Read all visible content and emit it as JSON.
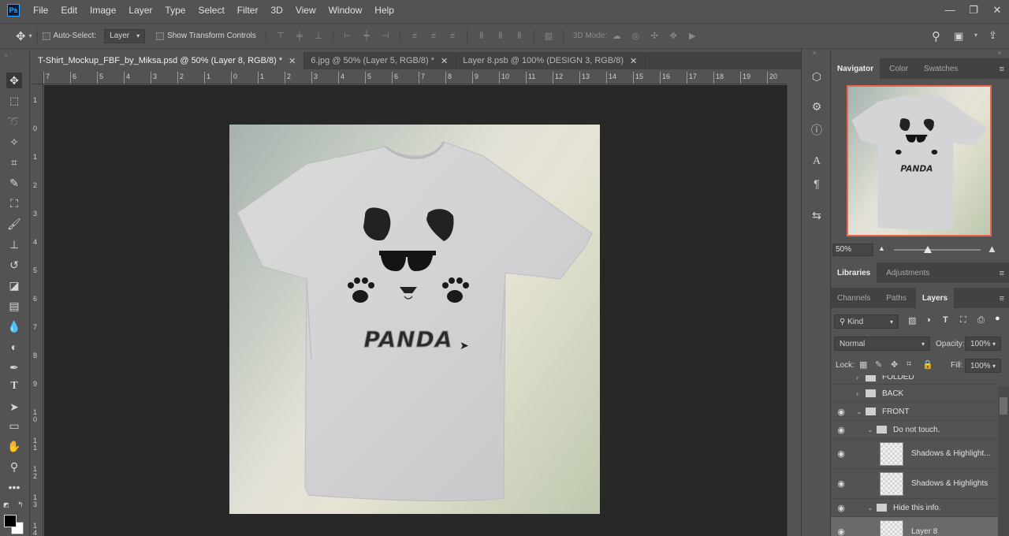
{
  "app": {
    "logo": "Ps"
  },
  "menu": [
    "File",
    "Edit",
    "Image",
    "Layer",
    "Type",
    "Select",
    "Filter",
    "3D",
    "View",
    "Window",
    "Help"
  ],
  "window_controls": [
    "—",
    "❐",
    "✕"
  ],
  "options": {
    "auto_select_label": "Auto-Select:",
    "auto_select_value": "Layer",
    "show_transform_label": "Show Transform Controls",
    "mode_3d_label": "3D Mode:"
  },
  "tabs": [
    {
      "label": "T-Shirt_Mockup_FBF_by_Miksa.psd @ 50% (Layer 8, RGB/8) *",
      "close": "✕"
    },
    {
      "label": "6.jpg @ 50% (Layer 5, RGB/8) *",
      "close": "✕"
    },
    {
      "label": "Layer 8.psb @ 100% (DESIGN 3, RGB/8)",
      "close": "✕"
    }
  ],
  "ruler_h_labels": [
    "7",
    "6",
    "5",
    "4",
    "3",
    "2",
    "1",
    "0",
    "1",
    "2",
    "3",
    "4",
    "5",
    "6",
    "7",
    "8",
    "9",
    "10",
    "11",
    "12",
    "13",
    "14",
    "15",
    "16",
    "17",
    "18",
    "19",
    "20"
  ],
  "ruler_v_labels": [
    "1",
    "0",
    "1",
    "2",
    "3",
    "4",
    "5",
    "6",
    "7",
    "8",
    "9",
    "1 0",
    "1 1",
    "1 2",
    "1 3",
    "1 4"
  ],
  "artwork": {
    "text": "PANDA"
  },
  "navigator": {
    "tabs": [
      "Navigator",
      "Color",
      "Swatches"
    ],
    "zoom": "50%",
    "thumb_text": "PANDA"
  },
  "libraries": {
    "tabs": [
      "Libraries",
      "Adjustments"
    ]
  },
  "layers_panel": {
    "tabs": [
      "Channels",
      "Paths",
      "Layers"
    ],
    "kind_label": "Kind",
    "blend_mode": "Normal",
    "opacity_label": "Opacity:",
    "opacity_value": "100%",
    "lock_label": "Lock:",
    "fill_label": "Fill:",
    "fill_value": "100%",
    "layers": [
      {
        "name": "FOLDED"
      },
      {
        "name": "BACK"
      },
      {
        "name": "FRONT"
      },
      {
        "name": "Do not touch."
      },
      {
        "name": "Shadows & Highlight..."
      },
      {
        "name": "Shadows & Highlights"
      },
      {
        "name": "Hide this info."
      },
      {
        "name": "Layer 8"
      }
    ]
  },
  "colors": {
    "bg": "#535353",
    "canvas": "#282828",
    "accent": "#31a8ff",
    "navigator_frame": "#e8654b"
  }
}
